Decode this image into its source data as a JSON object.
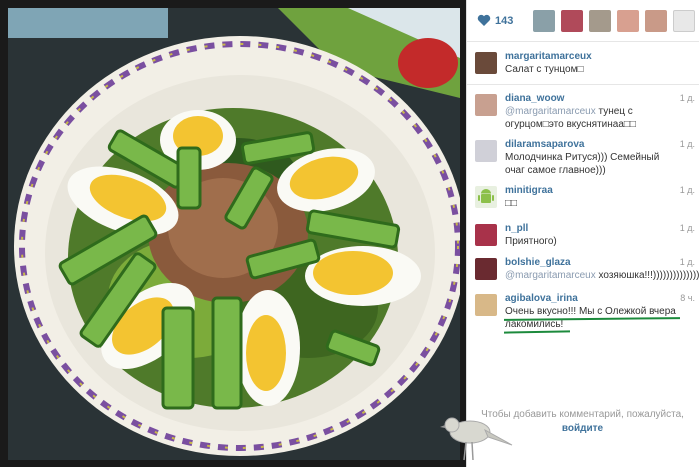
{
  "post": {
    "like_count": "143"
  },
  "comments": [
    {
      "user": "margaritamarceux",
      "time": "",
      "text": "Салат с тунцом□",
      "mention": ""
    },
    {
      "user": "diana_woow",
      "time": "1 д.",
      "mention": "@margaritamarceux",
      "text": " тунец с огурцом□это вкуснятинаа□□"
    },
    {
      "user": "dilaramsaparova",
      "time": "1 д.",
      "mention": "",
      "text": "Молодчинка Ритуся))) Семейный очаг самое главное)))"
    },
    {
      "user": "minitigraa",
      "time": "1 д.",
      "mention": "",
      "text": "□□"
    },
    {
      "user": "n_pll",
      "time": "1 д.",
      "mention": "",
      "text": "Приятного)"
    },
    {
      "user": "bolshie_glaza",
      "time": "1 д.",
      "mention": "@margaritamarceux",
      "text": " хозяюшка!!!))))))))))))))"
    },
    {
      "user": "agibalova_irina",
      "time": "8 ч.",
      "mention": "",
      "text": "Очень вкусно!!! Мы с Олежкой вчера лакомились!"
    }
  ],
  "footer": {
    "hint": "Чтобы добавить комментарий, пожалуйста,",
    "login": "войдите"
  }
}
